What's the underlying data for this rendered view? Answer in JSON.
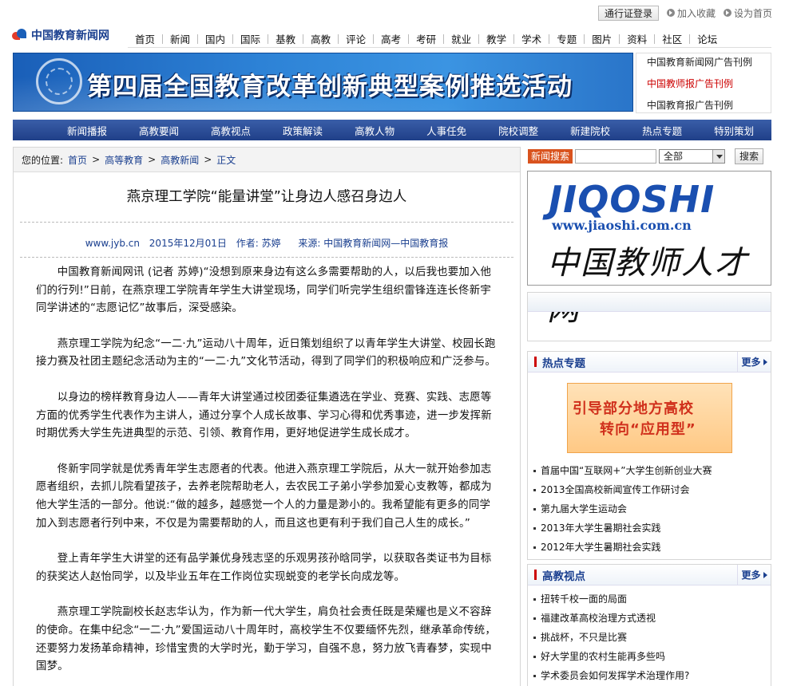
{
  "util": {
    "login_label": "通行证登录",
    "favorite_label": "加入收藏",
    "homepage_label": "设为首页"
  },
  "logo": {
    "text": "中国教育新闻网"
  },
  "main_nav": [
    "首页",
    "新闻",
    "国内",
    "国际",
    "基教",
    "高教",
    "评论",
    "高考",
    "考研",
    "就业",
    "教学",
    "学术",
    "专题",
    "图片",
    "资料",
    "社区",
    "论坛"
  ],
  "banner": {
    "text": "第四届全国教育改革创新典型案例推选活动"
  },
  "ad_links": [
    {
      "label": "中国教育新闻网广告刊例",
      "color": "#222222"
    },
    {
      "label": "中国教师报广告刊例",
      "color": "#cc0000"
    },
    {
      "label": "中国教育报广告刊例",
      "color": "#222222"
    }
  ],
  "sub_nav": [
    "新闻播报",
    "高教要闻",
    "高教视点",
    "政策解读",
    "高教人物",
    "人事任免",
    "院校调整",
    "新建院校",
    "热点专题",
    "特别策划"
  ],
  "breadcrumb": {
    "prefix": "您的位置:",
    "items": [
      "首页",
      "高等教育",
      "高教新闻",
      "正文"
    ],
    "sep": ">"
  },
  "article": {
    "title": "燕京理工学院“能量讲堂”让身边人感召身边人",
    "site": "www.jyb.cn",
    "date": "2015年12月01日",
    "author": "作者: 苏婷",
    "source": "来源: 中国教育新闻网—中国教育报",
    "paragraphs": [
      "中国教育新闻网讯 (记者 苏婷)“没想到原来身边有这么多需要帮助的人，以后我也要加入他们的行列!”日前，在燕京理工学院青年学生大讲堂现场，同学们听完学生组织雷锋连连长佟新宇同学讲述的“志愿记忆”故事后，深受感染。",
      "燕京理工学院为纪念“一二·九”运动八十周年，近日策划组织了以青年学生大讲堂、校园长跑接力赛及社团主题纪念活动为主的“一二·九”文化节活动，得到了同学们的积极响应和广泛参与。",
      "以身边的榜样教育身边人——青年大讲堂通过校团委征集遴选在学业、竞赛、实践、志愿等方面的优秀学生代表作为主讲人，通过分享个人成长故事、学习心得和优秀事迹，进一步发挥新时期优秀大学生先进典型的示范、引领、教育作用，更好地促进学生成长成才。",
      "佟新宇同学就是优秀青年学生志愿者的代表。他进入燕京理工学院后，从大一就开始参加志愿者组织，去抓儿院看望孩子，去养老院帮助老人，去农民工子弟小学参加爱心支教等，都成为他大学生活的一部分。他说:“做的越多，越感觉一个人的力量是渺小的。我希望能有更多的同学加入到志愿者行列中来，不仅是为需要帮助的人，而且这也更有利于我们自己人生的成长。”",
      "登上青年学生大讲堂的还有品学兼优身残志坚的乐观男孩孙晗同学，以获取各类证书为目标的获奖达人赵怡同学，以及毕业五年在工作岗位实现蜕变的老学长向成龙等。",
      "燕京理工学院副校长赵志华认为，作为新一代大学生，肩负社会责任既是荣耀也是义不容辞的使命。在集中纪念“一二·九”爱国运动八十周年时，高校学生不仅要缅怀先烈，继承革命传统，还要努力发扬革命精神，珍惜宝贵的大学时光，勤于学习，自强不息，努力放飞青春梦，实现中国梦。"
    ]
  },
  "search": {
    "label": "新闻搜索",
    "select_value": "全部",
    "button_label": "搜索"
  },
  "jiaoshi_ad": {
    "brand": "JIQOSHI",
    "url": "www.jiaoshi.com.cn",
    "cn": "中国教师人才网"
  },
  "hot_topics": {
    "title": "热点专题",
    "more": "更多",
    "promo_line1": "引导部分地方高校",
    "promo_line2": "转向“应用型”",
    "items": [
      "首届中国“互联网+”大学生创新创业大赛",
      "2013全国高校新闻宣传工作研讨会",
      "第九届大学生运动会",
      "2013年大学生暑期社会实践",
      "2012年大学生暑期社会实践"
    ]
  },
  "gaojiao_views": {
    "title": "高教视点",
    "more": "更多",
    "items": [
      "扭转千校一面的局面",
      "福建改革高校治理方式透视",
      "挑战杯，不只是比赛",
      "好大学里的农村生能再多些吗",
      "学术委员会如何发挥学术治理作用?"
    ]
  }
}
